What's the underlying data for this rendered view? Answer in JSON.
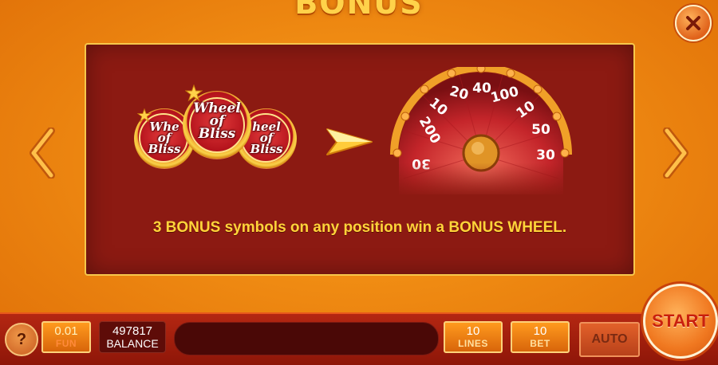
{
  "header": {
    "title": "BONUS"
  },
  "panel": {
    "symbols": [
      {
        "text": "Whe\nof\nBliss"
      },
      {
        "text": "Wheel\nof\nBliss"
      },
      {
        "text": "heel\nof\nBliss"
      }
    ],
    "wheel_numbers": [
      "200",
      "10",
      "20",
      "40",
      "100",
      "10",
      "50",
      "30",
      "30"
    ],
    "description": "3 BONUS symbols on any position win a BONUS WHEEL."
  },
  "bottom_bar": {
    "help_label": "?",
    "coin_value": "0.01",
    "coin_label": "FUN",
    "balance_value": "497817",
    "balance_label": "BALANCE",
    "lines_value": "10",
    "lines_label": "LINES",
    "bet_value": "10",
    "bet_label": "BET",
    "auto_label": "AUTO",
    "start_label": "START"
  },
  "colors": {
    "background": "#ef8a12",
    "panel": "#8c1a12",
    "panel_border": "#f6c84b",
    "text_accent": "#ffd43a",
    "start_text": "#c9200e"
  }
}
